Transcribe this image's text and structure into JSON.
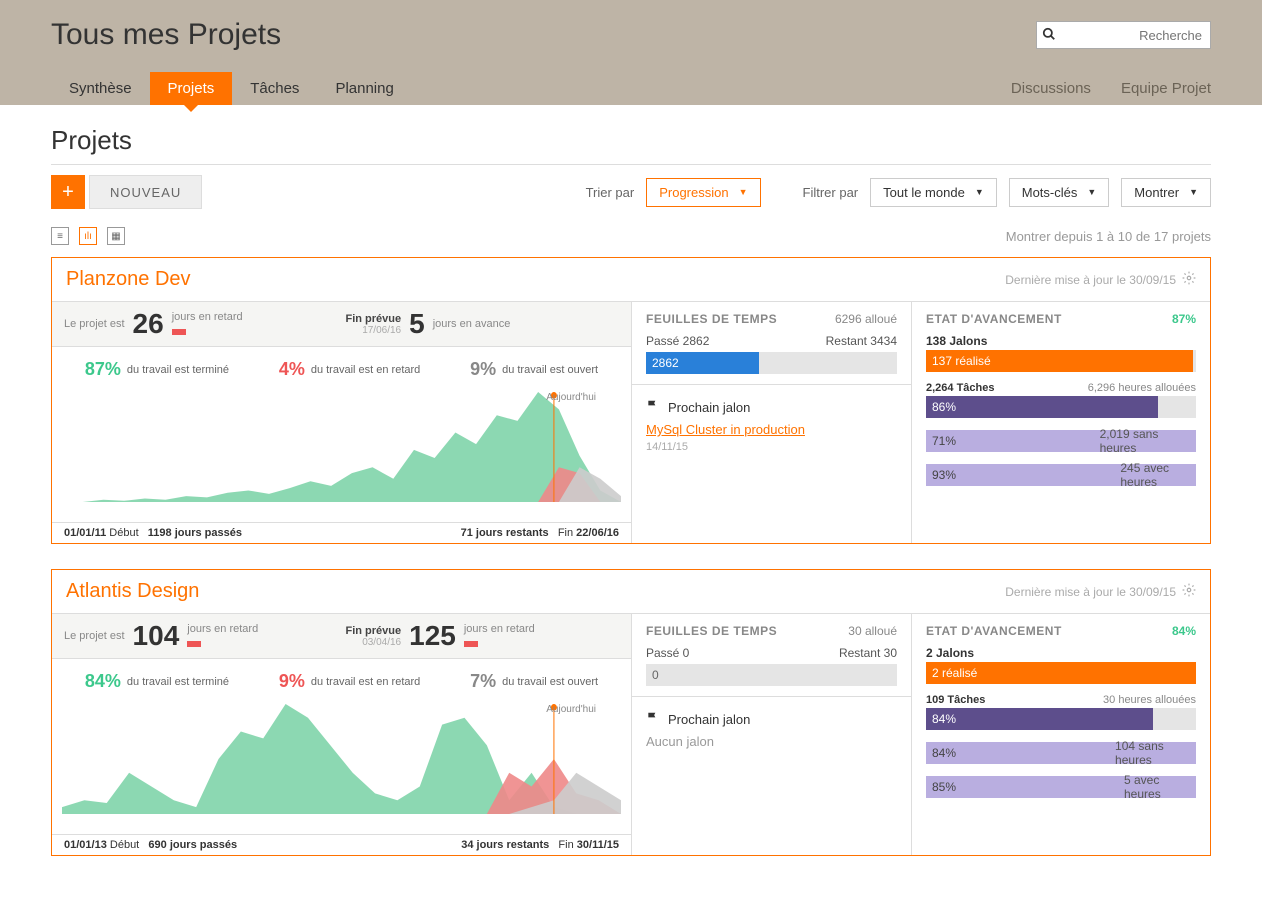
{
  "header": {
    "title": "Tous mes Projets",
    "search_placeholder": "Recherche"
  },
  "nav": {
    "tabs": [
      "Synthèse",
      "Projets",
      "Tâches",
      "Planning"
    ],
    "right": [
      "Discussions",
      "Equipe Projet"
    ]
  },
  "page": {
    "heading": "Projets",
    "new_button": "NOUVEAU",
    "sort_label": "Trier par",
    "sort_value": "Progression",
    "filter_label": "Filtrer par",
    "filter_value": "Tout le monde",
    "tags_label": "Mots-clés",
    "show_label": "Montrer",
    "counter": "Montrer depuis 1 à 10 de 17 projets"
  },
  "projects": [
    {
      "name": "Planzone Dev",
      "updated": "Dernière mise à jour le 30/09/15",
      "status": {
        "project_is": "Le projet est",
        "days_late": "26",
        "days_late_label": "jours en retard",
        "end_expected": "Fin prévue",
        "end_expected_date": "17/06/16",
        "end_days": "5",
        "end_days_label": "jours en avance"
      },
      "progress": {
        "done_pct": "87%",
        "done_label": "du travail est terminé",
        "late_pct": "4%",
        "late_label": "du travail est en retard",
        "open_pct": "9%",
        "open_label": "du travail est ouvert"
      },
      "chart_label_today": "Aujourd'hui",
      "timeline": {
        "start_date": "01/01/11",
        "start_label": "Début",
        "passed": "1198 jours passés",
        "remaining": "71 jours restants",
        "end_label": "Fin",
        "end_date": "22/06/16"
      },
      "timesheet": {
        "title": "FEUILLES DE TEMPS",
        "allocated": "6296 alloué",
        "spent_label": "Passé 2862",
        "remaining_label": "Restant 3434",
        "bar_value": "2862",
        "bar_pct": 45
      },
      "milestone": {
        "title": "Prochain jalon",
        "link": "MySql Cluster in production",
        "date": "14/11/15"
      },
      "advancement": {
        "title": "ETAT D'AVANCEMENT",
        "pct": "87%",
        "milestones_count": "138 Jalons",
        "milestones_done": "137 réalisé",
        "milestones_pct": 99,
        "tasks_count": "2,264 Tâches",
        "hours_allocated": "6,296 heures allouées",
        "tasks_pct_label": "86%",
        "tasks_pct": 86,
        "row1_pct_label": "71%",
        "row1_pct": 71,
        "row1_right": "2,019 sans heures",
        "row2_pct_label": "93%",
        "row2_pct": 93,
        "row2_right": "245 avec heures"
      }
    },
    {
      "name": "Atlantis Design",
      "updated": "Dernière mise à jour le 30/09/15",
      "status": {
        "project_is": "Le projet est",
        "days_late": "104",
        "days_late_label": "jours en retard",
        "end_expected": "Fin prévue",
        "end_expected_date": "03/04/16",
        "end_days": "125",
        "end_days_label": "jours en retard"
      },
      "progress": {
        "done_pct": "84%",
        "done_label": "du travail est terminé",
        "late_pct": "9%",
        "late_label": "du travail est en retard",
        "open_pct": "7%",
        "open_label": "du travail est ouvert"
      },
      "chart_label_today": "Aujourd'hui",
      "timeline": {
        "start_date": "01/01/13",
        "start_label": "Début",
        "passed": "690 jours passés",
        "remaining": "34 jours restants",
        "end_label": "Fin",
        "end_date": "30/11/15"
      },
      "timesheet": {
        "title": "FEUILLES DE TEMPS",
        "allocated": "30 alloué",
        "spent_label": "Passé 0",
        "remaining_label": "Restant 30",
        "bar_value": "0",
        "bar_pct": 0
      },
      "milestone": {
        "title": "Prochain jalon",
        "none": "Aucun jalon"
      },
      "advancement": {
        "title": "ETAT D'AVANCEMENT",
        "pct": "84%",
        "milestones_count": "2 Jalons",
        "milestones_done": "2 réalisé",
        "milestones_pct": 100,
        "tasks_count": "109 Tâches",
        "hours_allocated": "30 heures allouées",
        "tasks_pct_label": "84%",
        "tasks_pct": 84,
        "row1_pct_label": "84%",
        "row1_pct": 84,
        "row1_right": "104 sans heures",
        "row2_pct_label": "85%",
        "row2_pct": 85,
        "row2_right": "5 avec heures"
      }
    }
  ],
  "chart_data": [
    {
      "type": "area",
      "title": "Planzone Dev burndown",
      "x_range": [
        "01/01/11",
        "22/06/16"
      ],
      "today_marker": "Aujourd'hui",
      "series": [
        {
          "name": "done",
          "color": "#7fd4aa",
          "values": [
            0,
            0,
            2,
            1,
            3,
            2,
            5,
            4,
            8,
            10,
            7,
            12,
            18,
            14,
            25,
            30,
            20,
            45,
            38,
            60,
            50,
            75,
            70,
            95,
            80,
            40,
            10,
            0
          ]
        },
        {
          "name": "late",
          "color": "#e88",
          "values": [
            0,
            0,
            0,
            0,
            0,
            0,
            0,
            0,
            0,
            0,
            0,
            0,
            0,
            0,
            0,
            0,
            0,
            0,
            0,
            0,
            0,
            0,
            0,
            0,
            30,
            25,
            0,
            0
          ]
        },
        {
          "name": "open",
          "color": "#ccc",
          "values": [
            0,
            0,
            0,
            0,
            0,
            0,
            0,
            0,
            0,
            0,
            0,
            0,
            0,
            0,
            0,
            0,
            0,
            0,
            0,
            0,
            0,
            0,
            0,
            0,
            0,
            30,
            20,
            5
          ]
        }
      ]
    },
    {
      "type": "area",
      "title": "Atlantis Design burndown",
      "x_range": [
        "01/01/13",
        "30/11/15"
      ],
      "today_marker": "Aujourd'hui",
      "series": [
        {
          "name": "done",
          "color": "#7fd4aa",
          "values": [
            5,
            10,
            8,
            30,
            20,
            10,
            5,
            40,
            60,
            55,
            80,
            70,
            50,
            30,
            15,
            10,
            20,
            65,
            70,
            50,
            10,
            30,
            5,
            0,
            0,
            0
          ]
        },
        {
          "name": "late",
          "color": "#e88",
          "values": [
            0,
            0,
            0,
            0,
            0,
            0,
            0,
            0,
            0,
            0,
            0,
            0,
            0,
            0,
            0,
            0,
            0,
            0,
            0,
            0,
            30,
            20,
            40,
            15,
            10,
            0
          ]
        },
        {
          "name": "open",
          "color": "#ccc",
          "values": [
            0,
            0,
            0,
            0,
            0,
            0,
            0,
            0,
            0,
            0,
            0,
            0,
            0,
            0,
            0,
            0,
            0,
            0,
            0,
            0,
            0,
            5,
            10,
            30,
            20,
            10
          ]
        }
      ]
    }
  ]
}
